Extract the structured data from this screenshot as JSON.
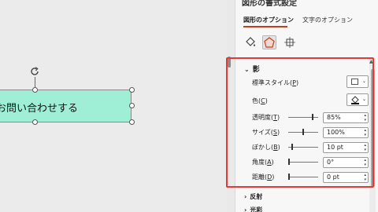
{
  "canvas": {
    "shape_text": "お問い合わせする",
    "shape_fill": "#9fefd7"
  },
  "pane": {
    "title": "図形の書式設定",
    "tabs": {
      "shape_options": "図形のオプション",
      "text_options": "文字のオプション"
    },
    "icons": [
      "fill-and-line-icon",
      "effects-icon",
      "size-and-properties-icon"
    ]
  },
  "shadow": {
    "header": "影",
    "preset_label": "標準スタイル(",
    "preset_key": "P",
    "color_label": "色(",
    "color_key": "C",
    "rows": [
      {
        "label": "透明度(",
        "key": "T",
        "value": "85%",
        "slider": 0.82
      },
      {
        "label": "サイズ(",
        "key": "S",
        "value": "100%",
        "slider": 0.5
      },
      {
        "label": "ぼかし(",
        "key": "B",
        "value": "10 pt",
        "slider": 0.1
      },
      {
        "label": "角度(",
        "key": "A",
        "value": "0°",
        "slider": 0.0
      },
      {
        "label": "距離(",
        "key": "D",
        "value": "0 pt",
        "slider": 0.0
      }
    ]
  },
  "sections": {
    "reflection": "反射",
    "glow": "光彩"
  },
  "colors": {
    "highlight_box": "#e53935",
    "tab_underline": "#c43e1c"
  }
}
